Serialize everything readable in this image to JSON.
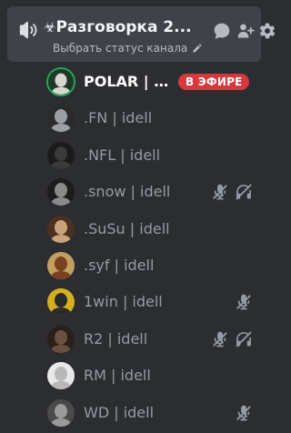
{
  "channel": {
    "icon_prefix": "☣",
    "name": "Разговорка 2...",
    "status_placeholder": "Выбрать статус канала"
  },
  "members": [
    {
      "name": "POLAR | id...",
      "speaking": true,
      "live_badge": "В ЭФИРЕ",
      "mic_muted": false,
      "deafened": false,
      "avatar_color": "#1e3a26",
      "avatar_fg": "#d8d6cf"
    },
    {
      "name": ".FN | idell",
      "speaking": false,
      "mic_muted": false,
      "deafened": false,
      "avatar_color": "#2a2a2a",
      "avatar_fg": "#9aa0a6"
    },
    {
      "name": ".NFL | idell",
      "speaking": false,
      "mic_muted": false,
      "deafened": false,
      "avatar_color": "#1a1a1a",
      "avatar_fg": "#3a3a3a"
    },
    {
      "name": ".snow | idell",
      "speaking": false,
      "mic_muted": true,
      "deafened": true,
      "avatar_color": "#1c1c1c",
      "avatar_fg": "#8a8a8a"
    },
    {
      "name": ".SuSu | idell",
      "speaking": false,
      "mic_muted": false,
      "deafened": false,
      "avatar_color": "#4a3020",
      "avatar_fg": "#c9a27a"
    },
    {
      "name": ".syf | idell",
      "speaking": false,
      "mic_muted": false,
      "deafened": false,
      "avatar_color": "#c0a060",
      "avatar_fg": "#7a4020"
    },
    {
      "name": "1win | idell",
      "speaking": false,
      "mic_muted": false,
      "deafened": false,
      "mic_only_muted": true,
      "avatar_color": "#d4b020",
      "avatar_fg": "#2a2a2a"
    },
    {
      "name": "R2 | idell",
      "speaking": false,
      "mic_muted": true,
      "deafened": true,
      "avatar_color": "#2a2018",
      "avatar_fg": "#6a5040"
    },
    {
      "name": "RM | idell",
      "speaking": false,
      "mic_muted": false,
      "deafened": false,
      "avatar_color": "#e8e8e8",
      "avatar_fg": "#b8b8b8"
    },
    {
      "name": "WD | idell",
      "speaking": false,
      "mic_muted": false,
      "deafened": false,
      "mic_only_muted": true,
      "avatar_color": "#4a4a4a",
      "avatar_fg": "#9a9a9a"
    }
  ],
  "colors": {
    "background": "#2b2d31",
    "card": "#404249",
    "muted_icon": "#949ba4",
    "live": "#da373c",
    "speaking_ring": "#23a55a"
  }
}
